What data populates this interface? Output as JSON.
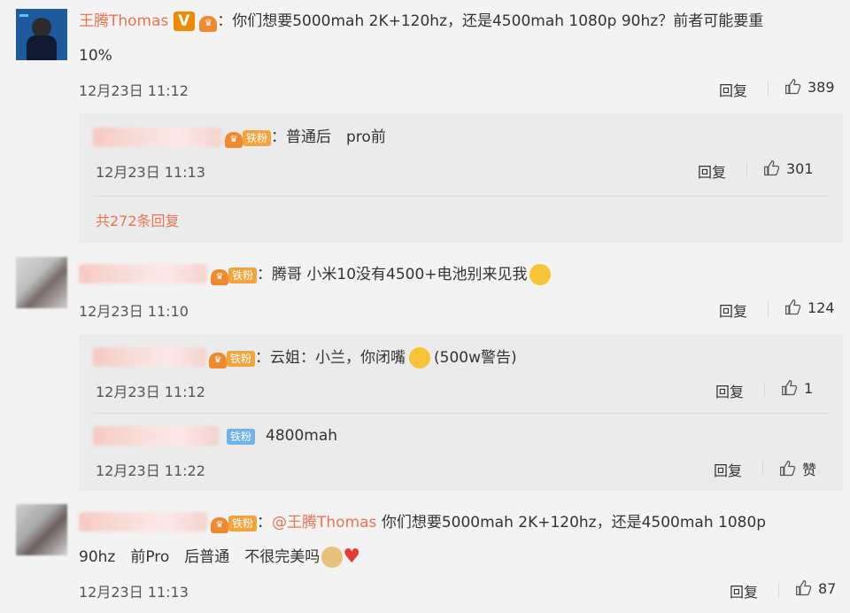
{
  "comments": [
    {
      "author": "王腾Thomas",
      "colon": "：",
      "text_line1": "你们想要5000mah 2K+120hz，还是4500mah 1080p 90hz？前者可能要重",
      "text_line2": "10%",
      "time": "12月23日 11:12",
      "reply_label": "回复",
      "likes": "389",
      "replies": [
        {
          "badge": "铁粉",
          "text": "：普通后　pro前",
          "time": "12月23日 11:13",
          "reply_label": "回复",
          "likes": "301"
        }
      ],
      "more_replies": "共272条回复"
    },
    {
      "badge": "铁粉",
      "text": "：腾哥 小米10没有4500+电池别来见我",
      "time": "12月23日 11:10",
      "reply_label": "回复",
      "likes": "124",
      "replies": [
        {
          "badge": "铁粉",
          "text": "：云姐：小兰，你闭嘴",
          "text_tail": "(500w警告)",
          "time": "12月23日 11:12",
          "reply_label": "回复",
          "likes": "1"
        },
        {
          "badge": "铁粉",
          "text": "4800mah",
          "time": "12月23日 11:22",
          "reply_label": "回复",
          "likes": "赞"
        }
      ]
    },
    {
      "badge": "铁粉",
      "mention": "@王腾Thomas",
      "text_line1": "你们想要5000mah 2K+120hz，还是4500mah 1080p",
      "text_line2": "90hz　前Pro　后普通　不很完美吗",
      "time": "12月23日 11:13",
      "reply_label": "回复",
      "likes": "87"
    }
  ],
  "colors": {
    "accent": "#eb7350",
    "panel": "#ebebeb",
    "background": "#f3f3f3"
  }
}
